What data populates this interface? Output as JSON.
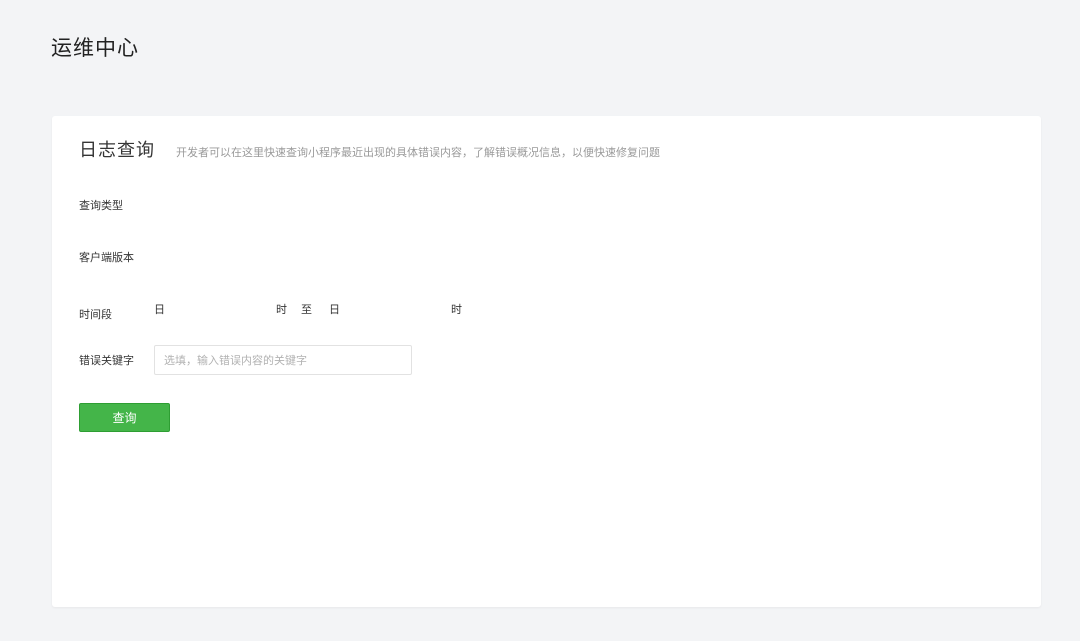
{
  "header": {
    "title": "运维中心"
  },
  "log_query": {
    "title": "日志查询",
    "description": "开发者可以在这里快速查询小程序最近出现的具体错误内容，了解错误概况信息，以便快速修复问题",
    "fields": {
      "query_type_label": "查询类型",
      "client_version_label": "客户端版本",
      "time_range_label": "时间段",
      "time_range": {
        "start_day": "日",
        "start_hour": "时",
        "to": "至",
        "end_day": "日",
        "end_hour": "时"
      },
      "keyword_label": "错误关键字",
      "keyword_value": "",
      "keyword_placeholder": "选填，输入错误内容的关键字"
    },
    "submit_label": "查询"
  },
  "colors": {
    "background": "#f3f4f6",
    "card": "#ffffff",
    "primary_button": "#44b549",
    "muted_text": "#9a9a9a"
  }
}
